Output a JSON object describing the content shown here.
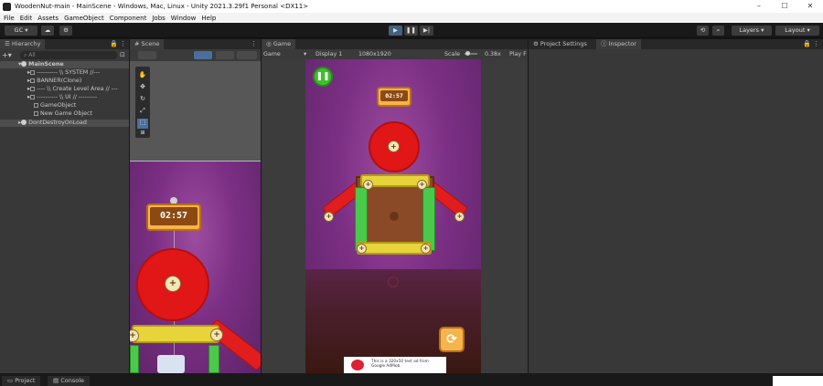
{
  "window": {
    "title": "WoodenNut-main - MainScene - Windows, Mac, Linux - Unity 2021.3.29f1 Personal <DX11>",
    "controls": [
      "–",
      "☐",
      "✕"
    ]
  },
  "menu": [
    "File",
    "Edit",
    "Assets",
    "GameObject",
    "Component",
    "Jobs",
    "Window",
    "Help"
  ],
  "toolbar": {
    "account_label": "GC ▾",
    "layers_label": "Layers",
    "layout_label": "Layout"
  },
  "hierarchy": {
    "tab_label": "Hierarchy",
    "search_placeholder": "All",
    "items": [
      {
        "label": "MainScene",
        "indent": 0,
        "type": "scene"
      },
      {
        "label": "---------- \\\\ SYSTEM //---",
        "indent": 2,
        "type": "go"
      },
      {
        "label": "BANNER(Clone)",
        "indent": 2,
        "type": "go"
      },
      {
        "label": "---- \\\\ Create Level Area // ---",
        "indent": 2,
        "type": "go"
      },
      {
        "label": "---------- \\\\ UI // ---------",
        "indent": 2,
        "type": "go"
      },
      {
        "label": "GameObject",
        "indent": 2,
        "type": "go"
      },
      {
        "label": "New Game Object",
        "indent": 2,
        "type": "go"
      },
      {
        "label": "DontDestroyOnLoad",
        "indent": 0,
        "type": "scene"
      }
    ]
  },
  "scene": {
    "tab_label": "Scene",
    "timer": "02:57"
  },
  "game": {
    "tab_label": "Game",
    "view_mode": "Game",
    "display": "Display 1",
    "resolution": "1080x1920",
    "scale_label": "Scale",
    "scale_value": "0.38x",
    "play_label": "Play F",
    "timer": "02:57",
    "ad_text": "This is a 320x50 test ad from Google AdMob."
  },
  "right_panel": {
    "project_settings_tab": "Project Settings",
    "inspector_tab": "Inspector"
  },
  "bottom": {
    "project_tab": "Project",
    "console_tab": "Console"
  },
  "colors": {
    "unity_dark": "#383838",
    "game_purple": "#7b2f84",
    "wheel_red": "#e11616",
    "timer_orange": "#f6b44a",
    "pause_green": "#3fbf2c",
    "play_blue": "#46607c"
  }
}
